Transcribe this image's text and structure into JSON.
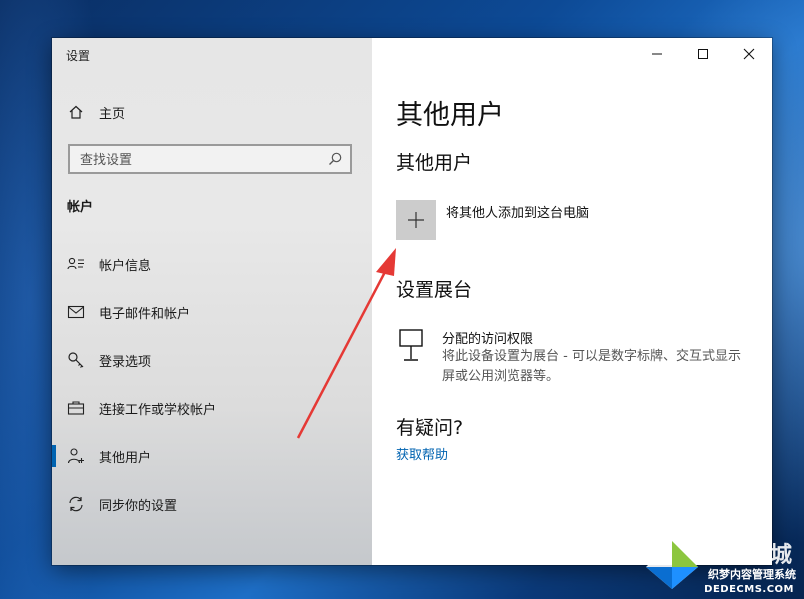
{
  "window": {
    "title": "设置"
  },
  "sidebar": {
    "home_label": "主页",
    "search_placeholder": "查找设置",
    "section": "帐户",
    "items": [
      {
        "label": "帐户信息",
        "icon": "account-info-icon"
      },
      {
        "label": "电子邮件和帐户",
        "icon": "mail-icon"
      },
      {
        "label": "登录选项",
        "icon": "key-icon"
      },
      {
        "label": "连接工作或学校帐户",
        "icon": "briefcase-icon"
      },
      {
        "label": "其他用户",
        "icon": "person-add-icon",
        "active": true
      },
      {
        "label": "同步你的设置",
        "icon": "sync-icon"
      }
    ]
  },
  "main": {
    "page_title": "其他用户",
    "other_users_heading": "其他用户",
    "add_user_label": "将其他人添加到这台电脑",
    "kiosk_heading": "设置展台",
    "kiosk_title": "分配的访问权限",
    "kiosk_description": "将此设备设置为展台 - 可以是数字标牌、交互式显示屏或公用浏览器等。",
    "help_heading": "有疑问?",
    "help_link": "获取帮助"
  },
  "watermark": {
    "brand": "系统城",
    "sub": "织梦内容管理系统",
    "url": "DEDECMS.COM"
  },
  "colors": {
    "accent": "#0063b1",
    "arrow": "#e53935",
    "sidebar_bg": "#e6e6e6"
  }
}
